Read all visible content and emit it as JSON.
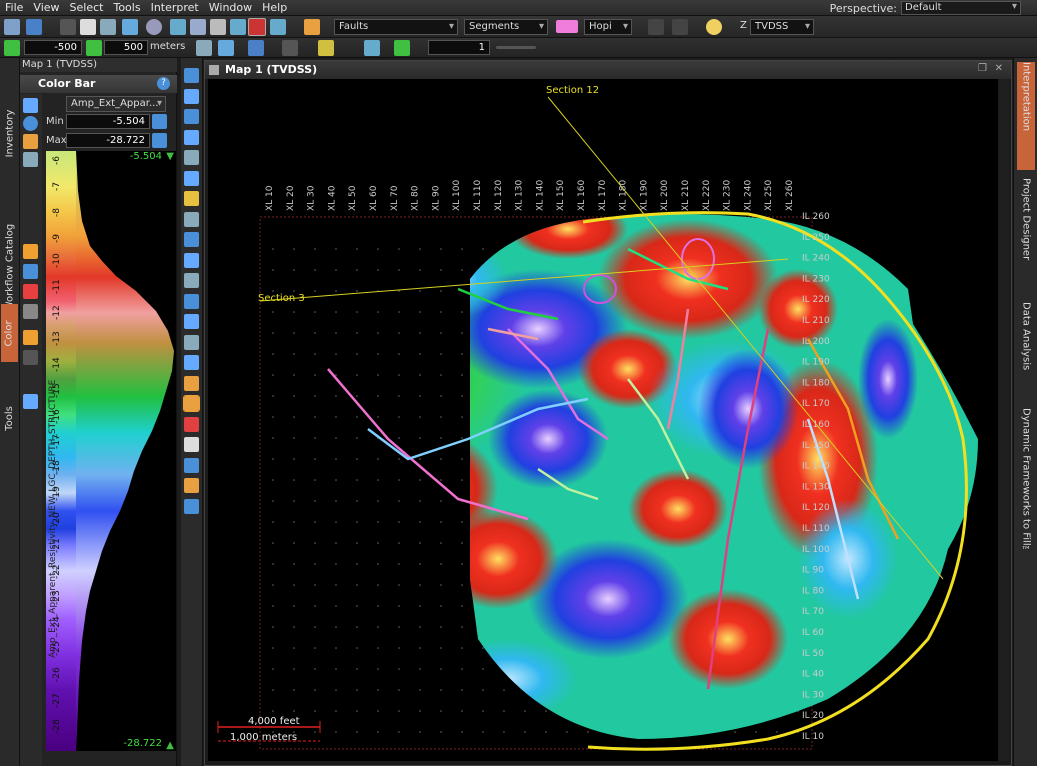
{
  "menu": [
    "File",
    "View",
    "Select",
    "Tools",
    "Interpret",
    "Window",
    "Help"
  ],
  "perspective": {
    "label": "Perspective:",
    "value": "Default"
  },
  "toolbar1": {
    "faults_dropdown": "Faults",
    "segments_dropdown": "Segments",
    "horizon_dropdown": "Hopi",
    "domain_prefix": "Z",
    "domain_dropdown": "TVDSS",
    "horizon_color": "#f07cdc"
  },
  "toolbar2": {
    "left_value": "-500",
    "right_value": "500",
    "unit": "meters",
    "level_value": "1"
  },
  "left_tabs": [
    "Inventory",
    "Workflow Catalog",
    "Color",
    "Tools"
  ],
  "color_panel": {
    "window_title": "Map 1 (TVDSS)",
    "header": "Color Bar",
    "attribute_dropdown": "Amp_Ext_Appar...",
    "min_label": "Min",
    "min_value": "-5.504",
    "max_label": "Max",
    "max_value": "-28.722",
    "top_readout": "-5.504",
    "bottom_readout": "-28.722",
    "ticks": [
      "-6",
      "-7",
      "-8",
      "-9",
      "-10",
      "-11",
      "-12",
      "-13",
      "-14",
      "-15",
      "-16",
      "-17",
      "-18",
      "-19",
      "-20",
      "-21",
      "-22",
      "-23",
      "-24",
      "-25",
      "-26",
      "-27",
      "-28"
    ],
    "vertical_label": "Amp_Ext_Apparent_Resistivity_NEW_LGC_DEPTH_STRUCTURE"
  },
  "map": {
    "title": "Map 1 (TVDSS)",
    "xl_labels": [
      "XL 10",
      "XL 20",
      "XL 30",
      "XL 40",
      "XL 50",
      "XL 60",
      "XL 70",
      "XL 80",
      "XL 90",
      "XL 100",
      "XL 110",
      "XL 120",
      "XL 130",
      "XL 140",
      "XL 150",
      "XL 160",
      "XL 170",
      "XL 180",
      "XL 190",
      "XL 200",
      "XL 210",
      "XL 220",
      "XL 230",
      "XL 240",
      "XL 250",
      "XL 260"
    ],
    "il_labels": [
      "IL 260",
      "IL 250",
      "IL 240",
      "IL 230",
      "IL 220",
      "IL 210",
      "IL 200",
      "IL 190",
      "IL 180",
      "IL 170",
      "IL 160",
      "IL 150",
      "IL 140",
      "IL 130",
      "IL 120",
      "IL 110",
      "IL 100",
      "IL 90",
      "IL 80",
      "IL 70",
      "IL 60",
      "IL 50",
      "IL 40",
      "IL 30",
      "IL 20",
      "IL 10"
    ],
    "section_12": "Section 12",
    "section_3": "Section 3",
    "scale_feet": "4,000 feet",
    "scale_meters": "1,000 meters"
  },
  "right_tabs": [
    "Interpretation",
    "Project Designer",
    "Data Analysis",
    "Dynamic Frameworks to Fill™"
  ],
  "colors": {
    "accent_tab": "#c8643a",
    "boundary": "#f2e020",
    "section_line": "#d8d020"
  }
}
